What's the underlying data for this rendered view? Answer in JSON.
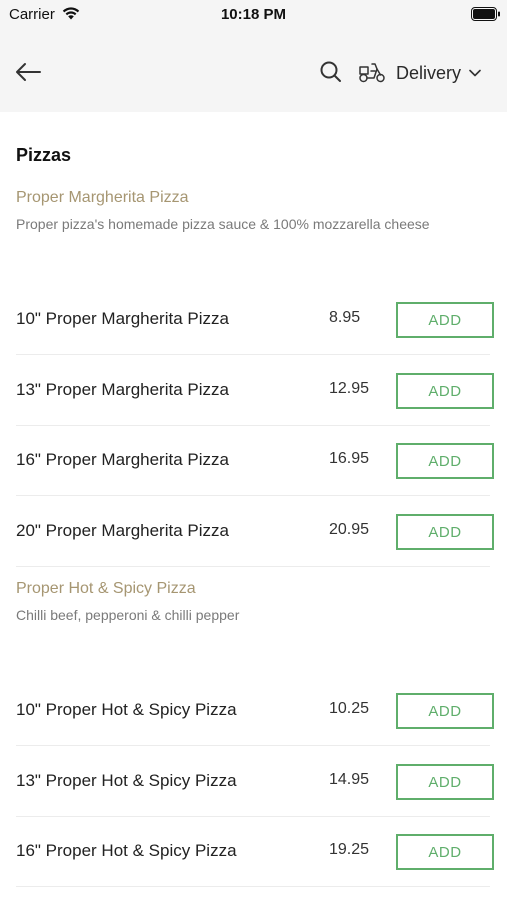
{
  "status_bar": {
    "carrier": "Carrier",
    "time": "10:18 PM"
  },
  "nav": {
    "back_icon": "back-arrow-icon",
    "search_icon": "search-icon",
    "delivery_icon": "scooter-icon",
    "delivery_label": "Delivery",
    "chevron_icon": "chevron-down-icon"
  },
  "section": {
    "title": "Pizzas"
  },
  "groups": [
    {
      "name": "Proper Margherita Pizza",
      "description": "Proper pizza's homemade pizza sauce & 100% mozzarella cheese",
      "items": [
        {
          "name": "10\" Proper Margherita Pizza",
          "price": "8.95",
          "button": "ADD"
        },
        {
          "name": "13\" Proper Margherita Pizza",
          "price": "12.95",
          "button": "ADD"
        },
        {
          "name": "16\" Proper Margherita Pizza",
          "price": "16.95",
          "button": "ADD"
        },
        {
          "name": "20\" Proper Margherita Pizza",
          "price": "20.95",
          "button": "ADD"
        }
      ]
    },
    {
      "name": "Proper Hot & Spicy Pizza",
      "description": "Chilli beef, pepperoni & chilli pepper",
      "items": [
        {
          "name": "10\" Proper Hot & Spicy Pizza",
          "price": "10.25",
          "button": "ADD"
        },
        {
          "name": "13\" Proper Hot & Spicy Pizza",
          "price": "14.95",
          "button": "ADD"
        },
        {
          "name": "16\" Proper Hot & Spicy Pizza",
          "price": "19.25",
          "button": "ADD"
        }
      ]
    }
  ],
  "colors": {
    "accent_green": "#5fae6b",
    "group_title": "#a69672",
    "header_bg": "#f5f5f5"
  }
}
